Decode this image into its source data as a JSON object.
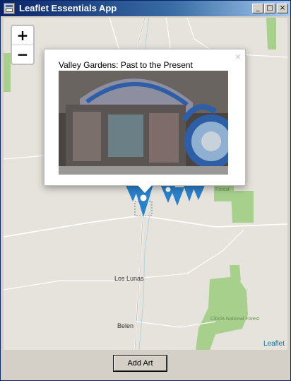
{
  "window": {
    "title": "Leaflet Essentials App",
    "minimize": "_",
    "maximize": "□",
    "close": "×"
  },
  "map": {
    "zoom_in": "+",
    "zoom_out": "−",
    "labels": {
      "los_lunas": "Los Lunas",
      "belen": "Belen",
      "cibola": "Cibola National Forest",
      "forest_small": "Forest"
    },
    "attribution": "Leaflet",
    "popup": {
      "title": "Valley Gardens: Past to the Present",
      "close": "×",
      "photo_icon": "mosaic-art-photo"
    }
  },
  "footer": {
    "add_button": "Add Art"
  },
  "colors": {
    "titlebar": "#0a246a",
    "forest": "#a8d08d",
    "marker": "#2a81cb",
    "map_bg": "#e6e2dc"
  }
}
